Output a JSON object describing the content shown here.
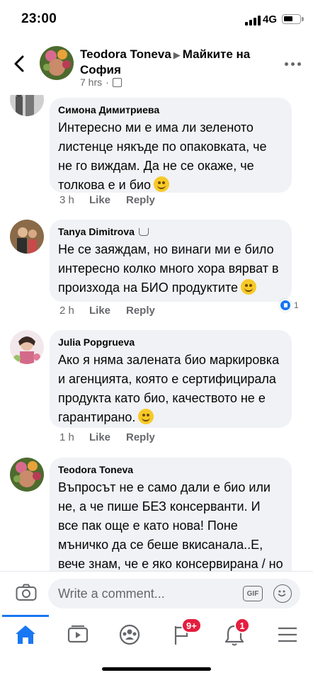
{
  "status_bar": {
    "time": "23:00",
    "network": "4G"
  },
  "header": {
    "author": "Teodora Toneva",
    "group": "Майките на София",
    "time": "7 hrs"
  },
  "comments": [
    {
      "name": "Симона Димитриева",
      "text": "Интересно ми е има ли зеленото листенце някъде по опаковката, че не го виждам. Да не се окаже, че толкова е и био",
      "time": "3 h",
      "like": "Like",
      "reply": "Reply"
    },
    {
      "name": "Tanya Dimitrova",
      "text": "Не се заяждам, но винаги ми е било интересно колко много хора вярват в произхода на БИО продуктите",
      "time": "2 h",
      "like": "Like",
      "reply": "Reply",
      "reactions": "1"
    },
    {
      "name": "Julia Popgrueva",
      "text": "Ако я няма заленатa био маркировка и агенцията, която е сертифицирала продукта като био, качеството не е гарантирано.",
      "time": "1 h",
      "like": "Like",
      "reply": "Reply"
    },
    {
      "name": "Teodora Toneva",
      "text": "Въпросът не е само дали е био или не, а че пише БЕЗ консерванти. И все пак още е като нова! Поне мъничко да се беше вкисанала..Е, вече знам, че е яко консервирана / но пък не знам с какво/. На"
    }
  ],
  "composer": {
    "placeholder": "Write a comment...",
    "gif": "GIF"
  },
  "tabbar": {
    "video_badge": "9+",
    "notifications_badge": "1"
  },
  "colors": {
    "accent": "#1877f2",
    "badge": "#e41e3f",
    "bubble": "#f0f2f5"
  }
}
